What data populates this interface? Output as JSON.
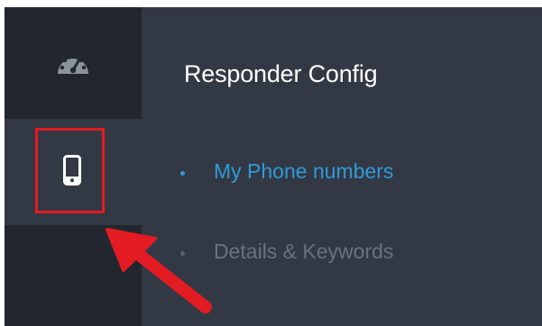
{
  "sidebar": {
    "items": [
      {
        "name": "dashboard",
        "icon": "dashboard-gauge-icon"
      },
      {
        "name": "phone",
        "icon": "mobile-phone-icon",
        "selected": true
      }
    ]
  },
  "panel": {
    "title": "Responder Config",
    "nav": [
      {
        "label": "My Phone numbers",
        "active": true
      },
      {
        "label": "Details & Keywords",
        "active": false
      }
    ]
  },
  "annotation": {
    "type": "red-box-and-arrow",
    "target": "mobile-phone-icon",
    "color": "#e31b23"
  },
  "colors": {
    "rail": "#22262e",
    "panel": "#333944",
    "accent": "#2f9ad8",
    "muted": "#6a717c",
    "annotation": "#e31b23"
  }
}
